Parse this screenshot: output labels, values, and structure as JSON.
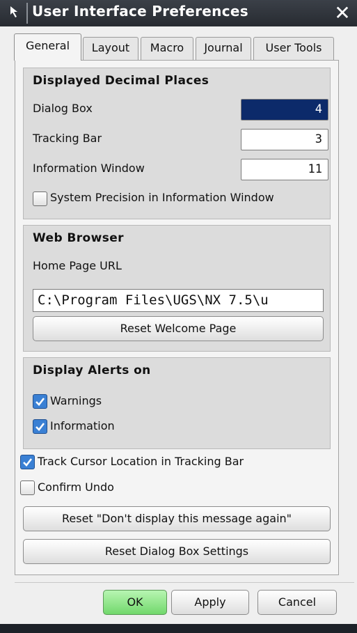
{
  "window": {
    "title": "User Interface Preferences"
  },
  "tabs": [
    {
      "label": "General",
      "active": true
    },
    {
      "label": "Layout",
      "active": false
    },
    {
      "label": "Macro",
      "active": false
    },
    {
      "label": "Journal",
      "active": false
    },
    {
      "label": "User Tools",
      "active": false
    }
  ],
  "decimal_places": {
    "title": "Displayed Decimal Places",
    "dialog_box": {
      "label": "Dialog Box",
      "value": "4"
    },
    "tracking_bar": {
      "label": "Tracking Bar",
      "value": "3"
    },
    "information_window": {
      "label": "Information Window",
      "value": "11"
    },
    "system_precision": {
      "label": "System Precision in Information Window",
      "checked": false
    }
  },
  "web_browser": {
    "title": "Web Browser",
    "home_page_label": "Home Page URL",
    "home_page_value": "C:\\Program Files\\UGS\\NX 7.5\\u",
    "reset_button": "Reset Welcome Page"
  },
  "alerts": {
    "title": "Display Alerts on",
    "warnings": {
      "label": "Warnings",
      "checked": true
    },
    "information": {
      "label": "Information",
      "checked": true
    }
  },
  "options": {
    "track_cursor": {
      "label": "Track Cursor Location in Tracking Bar",
      "checked": true
    },
    "confirm_undo": {
      "label": "Confirm Undo",
      "checked": false
    }
  },
  "buttons": {
    "reset_dont_display": "Reset \"Don't display this message again\"",
    "reset_dialog": "Reset Dialog Box Settings",
    "ok": "OK",
    "apply": "Apply",
    "cancel": "Cancel"
  },
  "colors": {
    "accent_selection": "#0c2a6a",
    "checkbox_checked": "#3a80d4",
    "ok_button": "#72d86c"
  }
}
